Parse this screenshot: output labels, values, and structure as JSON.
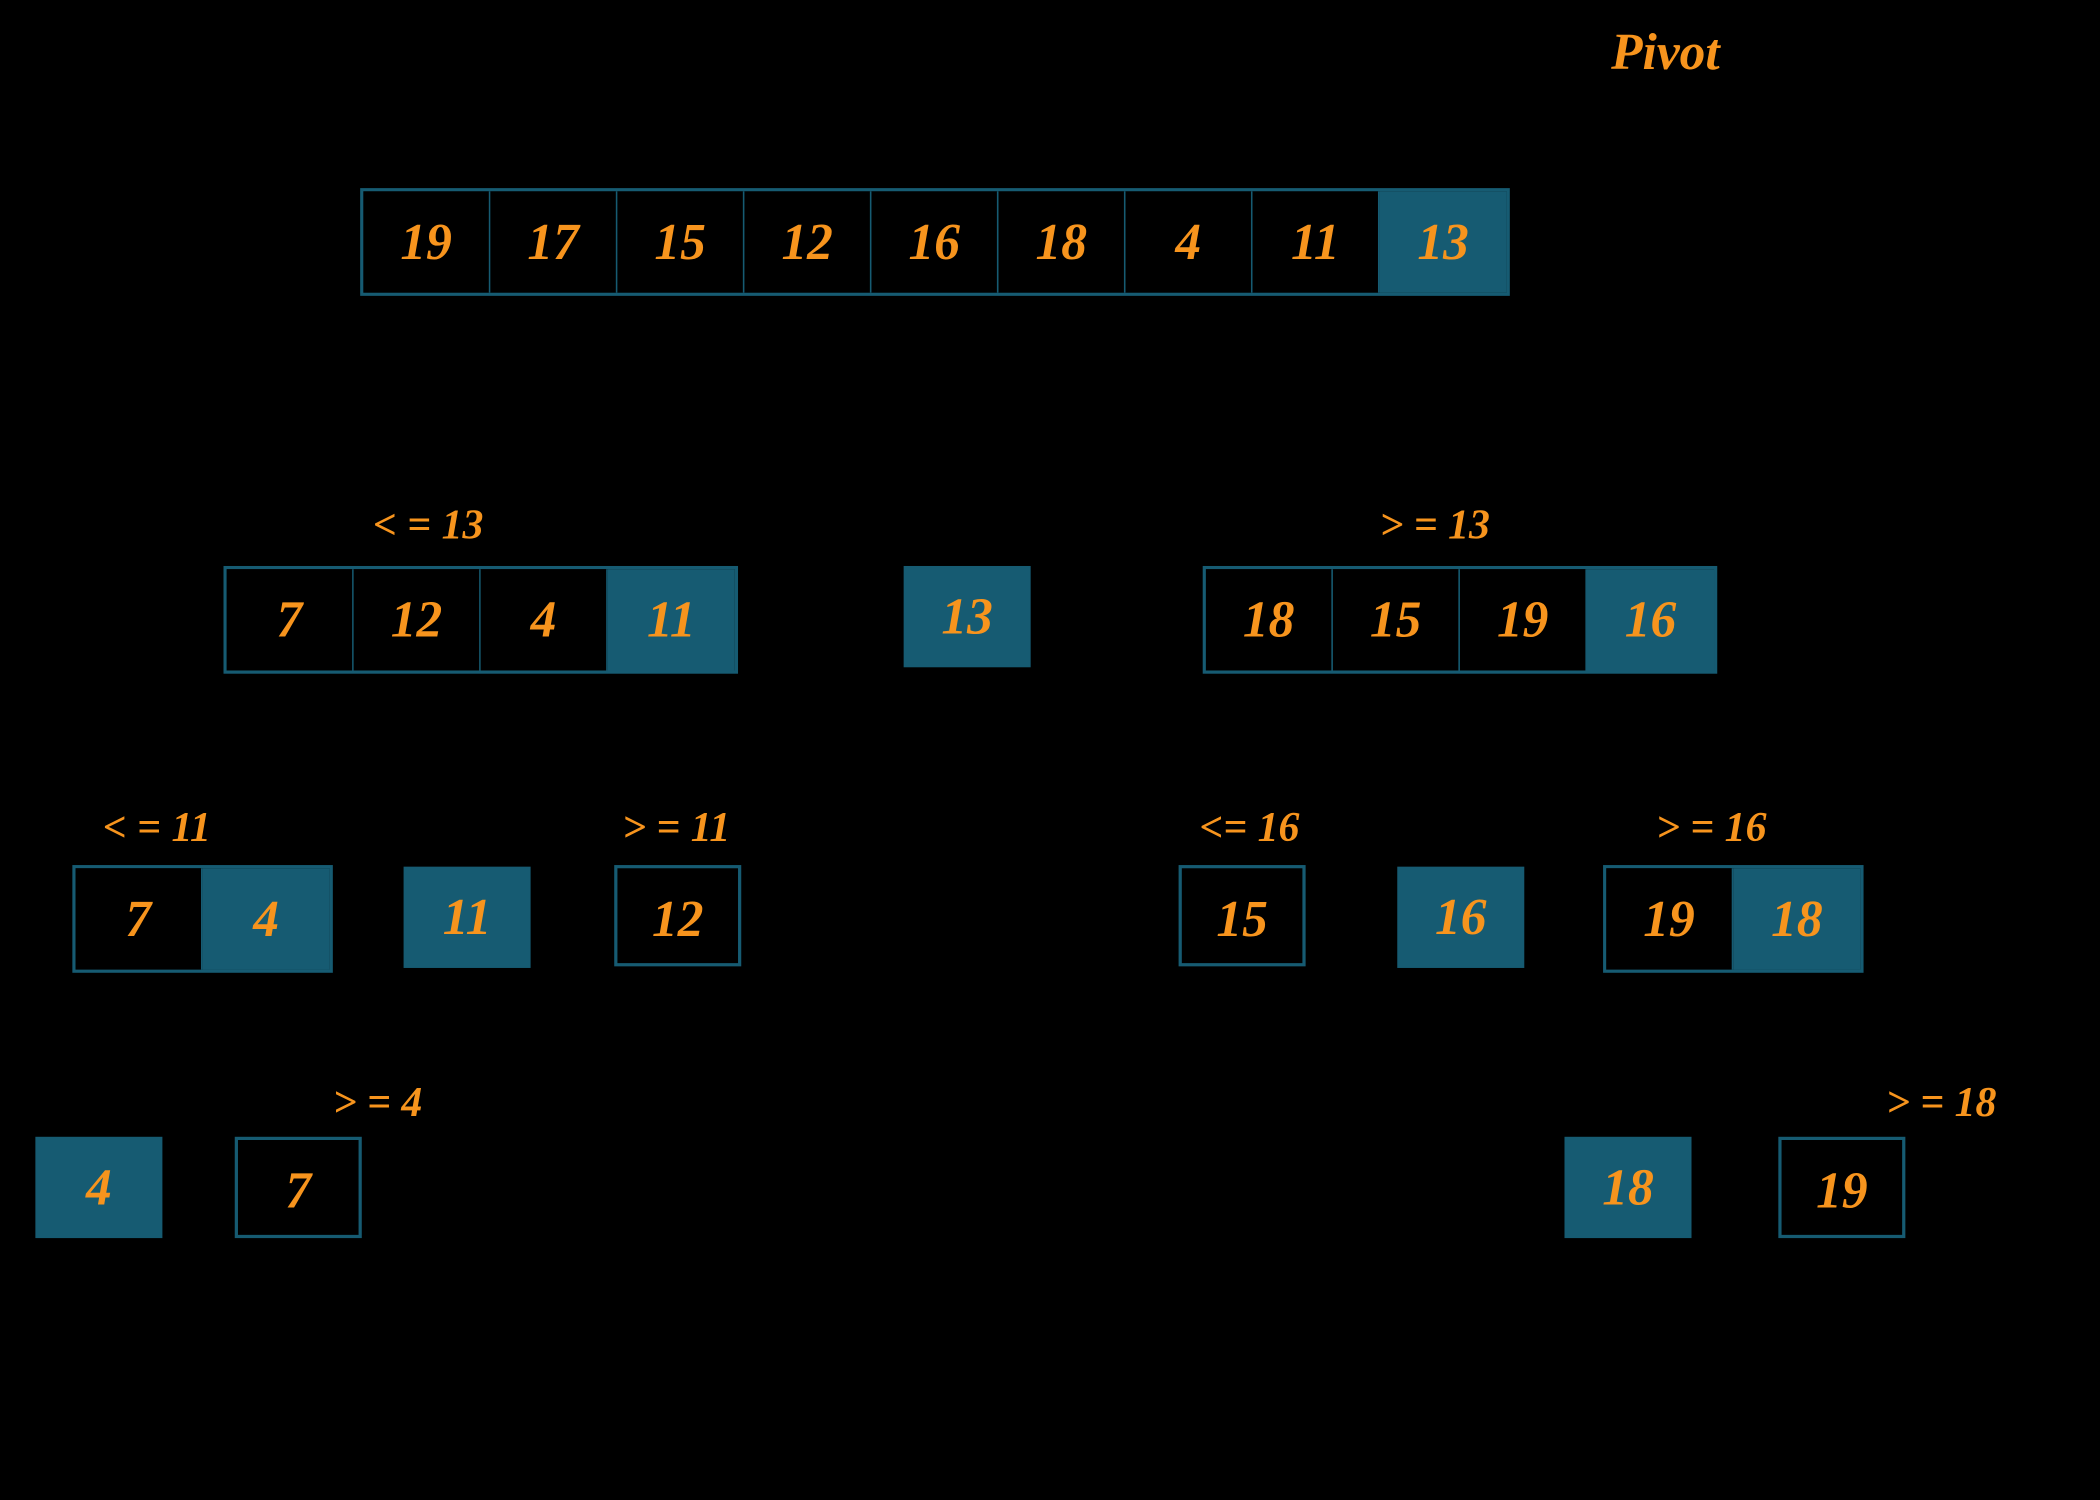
{
  "title_pivot": "Pivot",
  "level0": {
    "cells": [
      "19",
      "17",
      "15",
      "12",
      "16",
      "18",
      "4",
      "11",
      "13"
    ],
    "pivot_index": 8
  },
  "level1": {
    "left_label": "< = 13",
    "right_label": "> = 13",
    "left_cells": [
      "7",
      "12",
      "4",
      "11"
    ],
    "left_pivot_index": 3,
    "center_value": "13",
    "right_cells": [
      "18",
      "15",
      "19",
      "16"
    ],
    "right_pivot_index": 3
  },
  "level2": {
    "ll_label": "< = 11",
    "lr_label": "> = 11",
    "rl_label": "<= 16",
    "rr_label": "> = 16",
    "ll_cells": [
      "7",
      "4"
    ],
    "ll_pivot_index": 1,
    "l_center": "11",
    "lr_cell": "12",
    "rl_cell": "15",
    "r_center": "16",
    "rr_cells": [
      "19",
      "18"
    ],
    "rr_pivot_index": 1
  },
  "level3": {
    "l_label": "> = 4",
    "r_label": "> = 18",
    "l_pivot": "4",
    "l_value": "7",
    "r_pivot": "18",
    "r_value": "19"
  },
  "colors": {
    "accent": "#f7941d",
    "cell_border": "#165b72",
    "pivot_bg": "#165b72",
    "bg": "#000000"
  }
}
